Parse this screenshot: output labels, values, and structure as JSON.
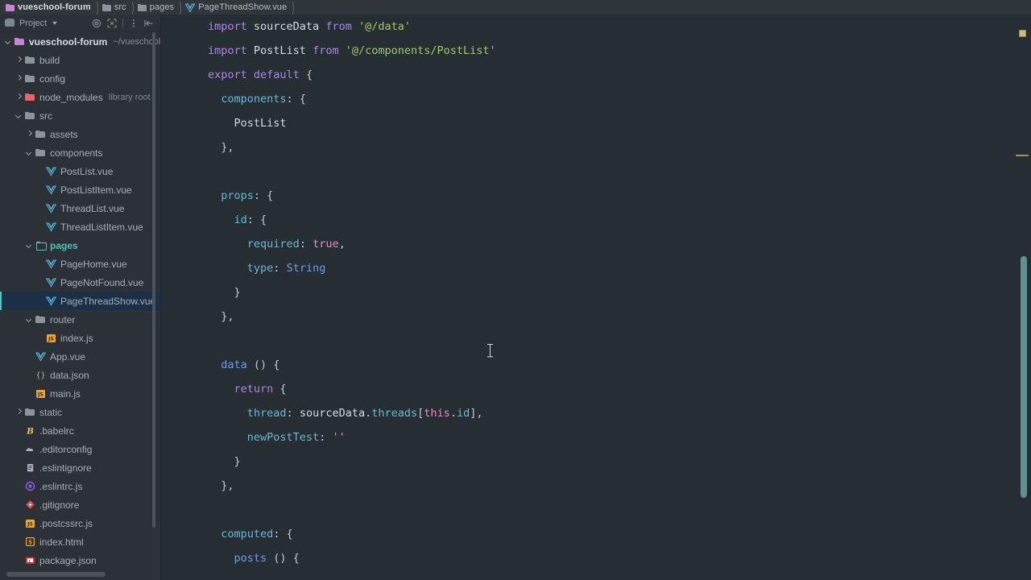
{
  "breadcrumb": {
    "items": [
      {
        "label": "vueschool-forum",
        "icon": "folder-project-icon",
        "kind": "project"
      },
      {
        "label": "src",
        "icon": "folder-icon",
        "kind": "folder"
      },
      {
        "label": "pages",
        "icon": "folder-icon",
        "kind": "folder"
      },
      {
        "label": "PageThreadShow.vue",
        "icon": "vue-file-icon",
        "kind": "file"
      }
    ],
    "separator": ")"
  },
  "panel": {
    "title": "Project",
    "caret": "▾",
    "tools": [
      {
        "name": "select-opened-file-icon",
        "title": "Select Opened File"
      },
      {
        "name": "collapse-all-icon",
        "title": "Collapse All"
      },
      {
        "name": "options-menu-icon",
        "title": "Options"
      },
      {
        "name": "hide-panel-icon",
        "title": "Hide"
      }
    ]
  },
  "tree": {
    "items": [
      {
        "label": "vueschool-forum",
        "note": "~/vueschool/",
        "indent": 0,
        "arrow": "expanded",
        "icon": "folder-project-icon",
        "state": "root"
      },
      {
        "label": "build",
        "note": "",
        "indent": 1,
        "arrow": "collapsed",
        "icon": "folder-icon",
        "state": ""
      },
      {
        "label": "config",
        "note": "",
        "indent": 1,
        "arrow": "collapsed",
        "icon": "folder-icon",
        "state": ""
      },
      {
        "label": "node_modules",
        "note": "library root",
        "indent": 1,
        "arrow": "collapsed",
        "icon": "folder-red-icon",
        "state": ""
      },
      {
        "label": "src",
        "note": "",
        "indent": 1,
        "arrow": "expanded",
        "icon": "folder-icon",
        "state": ""
      },
      {
        "label": "assets",
        "note": "",
        "indent": 2,
        "arrow": "collapsed",
        "icon": "folder-icon",
        "state": ""
      },
      {
        "label": "components",
        "note": "",
        "indent": 2,
        "arrow": "expanded",
        "icon": "folder-icon",
        "state": ""
      },
      {
        "label": "PostList.vue",
        "note": "",
        "indent": 3,
        "arrow": "",
        "icon": "vue-file-icon",
        "state": ""
      },
      {
        "label": "PostListItem.vue",
        "note": "",
        "indent": 3,
        "arrow": "",
        "icon": "vue-file-icon",
        "state": ""
      },
      {
        "label": "ThreadList.vue",
        "note": "",
        "indent": 3,
        "arrow": "",
        "icon": "vue-file-icon",
        "state": ""
      },
      {
        "label": "ThreadListItem.vue",
        "note": "",
        "indent": 3,
        "arrow": "",
        "icon": "vue-file-icon",
        "state": ""
      },
      {
        "label": "pages",
        "note": "",
        "indent": 2,
        "arrow": "expanded",
        "icon": "folder-open-icon",
        "state": "dir-active"
      },
      {
        "label": "PageHome.vue",
        "note": "",
        "indent": 3,
        "arrow": "",
        "icon": "vue-file-icon",
        "state": ""
      },
      {
        "label": "PageNotFound.vue",
        "note": "",
        "indent": 3,
        "arrow": "",
        "icon": "vue-file-icon",
        "state": ""
      },
      {
        "label": "PageThreadShow.vue",
        "note": "",
        "indent": 3,
        "arrow": "",
        "icon": "vue-file-icon",
        "state": "selected"
      },
      {
        "label": "router",
        "note": "",
        "indent": 2,
        "arrow": "expanded",
        "icon": "folder-icon",
        "state": ""
      },
      {
        "label": "index.js",
        "note": "",
        "indent": 3,
        "arrow": "",
        "icon": "js-file-icon",
        "state": ""
      },
      {
        "label": "App.vue",
        "note": "",
        "indent": 2,
        "arrow": "",
        "icon": "vue-file-icon",
        "state": ""
      },
      {
        "label": "data.json",
        "note": "",
        "indent": 2,
        "arrow": "",
        "icon": "json-file-icon",
        "state": ""
      },
      {
        "label": "main.js",
        "note": "",
        "indent": 2,
        "arrow": "",
        "icon": "js-file-icon",
        "state": ""
      },
      {
        "label": "static",
        "note": "",
        "indent": 1,
        "arrow": "collapsed",
        "icon": "folder-icon",
        "state": ""
      },
      {
        "label": ".babelrc",
        "note": "",
        "indent": 1,
        "arrow": "",
        "icon": "babel-file-icon",
        "state": ""
      },
      {
        "label": ".editorconfig",
        "note": "",
        "indent": 1,
        "arrow": "",
        "icon": "editorconfig-file-icon",
        "state": ""
      },
      {
        "label": ".eslintignore",
        "note": "",
        "indent": 1,
        "arrow": "",
        "icon": "eslintignore-file-icon",
        "state": ""
      },
      {
        "label": ".eslintrc.js",
        "note": "",
        "indent": 1,
        "arrow": "",
        "icon": "eslint-file-icon",
        "state": ""
      },
      {
        "label": ".gitignore",
        "note": "",
        "indent": 1,
        "arrow": "",
        "icon": "git-file-icon",
        "state": ""
      },
      {
        "label": ".postcssrc.js",
        "note": "",
        "indent": 1,
        "arrow": "",
        "icon": "js-file-icon",
        "state": ""
      },
      {
        "label": "index.html",
        "note": "",
        "indent": 1,
        "arrow": "",
        "icon": "html-file-icon",
        "state": ""
      },
      {
        "label": "package.json",
        "note": "",
        "indent": 1,
        "arrow": "",
        "icon": "npm-file-icon",
        "state": ""
      }
    ]
  },
  "editor": {
    "file": "PageThreadShow.vue",
    "lines": [
      [
        {
          "t": "import",
          "c": "kw"
        },
        {
          "t": " sourceData ",
          "c": "def"
        },
        {
          "t": "from",
          "c": "kw"
        },
        {
          "t": " ",
          "c": "def"
        },
        {
          "t": "'@/data'",
          "c": "str"
        }
      ],
      [
        {
          "t": "import",
          "c": "kw"
        },
        {
          "t": " PostList ",
          "c": "def"
        },
        {
          "t": "from",
          "c": "kw"
        },
        {
          "t": " ",
          "c": "def"
        },
        {
          "t": "'@/components/PostList'",
          "c": "str"
        }
      ],
      [
        {
          "t": "export",
          "c": "kw"
        },
        {
          "t": " ",
          "c": "def"
        },
        {
          "t": "default",
          "c": "kw"
        },
        {
          "t": " {",
          "c": "punc"
        }
      ],
      [
        {
          "t": "  ",
          "c": "def"
        },
        {
          "t": "components",
          "c": "prop"
        },
        {
          "t": ": {",
          "c": "punc"
        }
      ],
      [
        {
          "t": "    PostList",
          "c": "def"
        }
      ],
      [
        {
          "t": "  },",
          "c": "punc"
        }
      ],
      [],
      [
        {
          "t": "  ",
          "c": "def"
        },
        {
          "t": "props",
          "c": "prop"
        },
        {
          "t": ": {",
          "c": "punc"
        }
      ],
      [
        {
          "t": "    ",
          "c": "def"
        },
        {
          "t": "id",
          "c": "prop"
        },
        {
          "t": ": {",
          "c": "punc"
        }
      ],
      [
        {
          "t": "      ",
          "c": "def"
        },
        {
          "t": "required",
          "c": "prop"
        },
        {
          "t": ": ",
          "c": "punc"
        },
        {
          "t": "true",
          "c": "lit"
        },
        {
          "t": ",",
          "c": "punc"
        }
      ],
      [
        {
          "t": "      ",
          "c": "def"
        },
        {
          "t": "type",
          "c": "prop"
        },
        {
          "t": ": ",
          "c": "punc"
        },
        {
          "t": "String",
          "c": "fn"
        }
      ],
      [
        {
          "t": "    }",
          "c": "punc"
        }
      ],
      [
        {
          "t": "  },",
          "c": "punc"
        }
      ],
      [],
      [
        {
          "t": "  ",
          "c": "def"
        },
        {
          "t": "data",
          "c": "fn"
        },
        {
          "t": " () {",
          "c": "punc"
        }
      ],
      [
        {
          "t": "    ",
          "c": "def"
        },
        {
          "t": "return",
          "c": "kw"
        },
        {
          "t": " {",
          "c": "punc"
        }
      ],
      [
        {
          "t": "      ",
          "c": "def"
        },
        {
          "t": "thread",
          "c": "prop"
        },
        {
          "t": ": ",
          "c": "punc"
        },
        {
          "t": "sourceData",
          "c": "def"
        },
        {
          "t": ".",
          "c": "punc"
        },
        {
          "t": "threads",
          "c": "prop"
        },
        {
          "t": "[",
          "c": "punc"
        },
        {
          "t": "this",
          "c": "lit"
        },
        {
          "t": ".",
          "c": "punc"
        },
        {
          "t": "id",
          "c": "prop"
        },
        {
          "t": "],",
          "c": "punc"
        }
      ],
      [
        {
          "t": "      ",
          "c": "def"
        },
        {
          "t": "newPostTest",
          "c": "prop"
        },
        {
          "t": ": ",
          "c": "punc"
        },
        {
          "t": "''",
          "c": "lit"
        }
      ],
      [
        {
          "t": "    }",
          "c": "punc"
        }
      ],
      [
        {
          "t": "  },",
          "c": "punc"
        }
      ],
      [],
      [
        {
          "t": "  ",
          "c": "def"
        },
        {
          "t": "computed",
          "c": "prop"
        },
        {
          "t": ": {",
          "c": "punc"
        }
      ],
      [
        {
          "t": "    ",
          "c": "def"
        },
        {
          "t": "posts",
          "c": "fn"
        },
        {
          "t": " () {",
          "c": "punc"
        }
      ]
    ]
  },
  "markers": {
    "warning_marker": "warning",
    "scrollbar": "vertical-scrollbar"
  }
}
